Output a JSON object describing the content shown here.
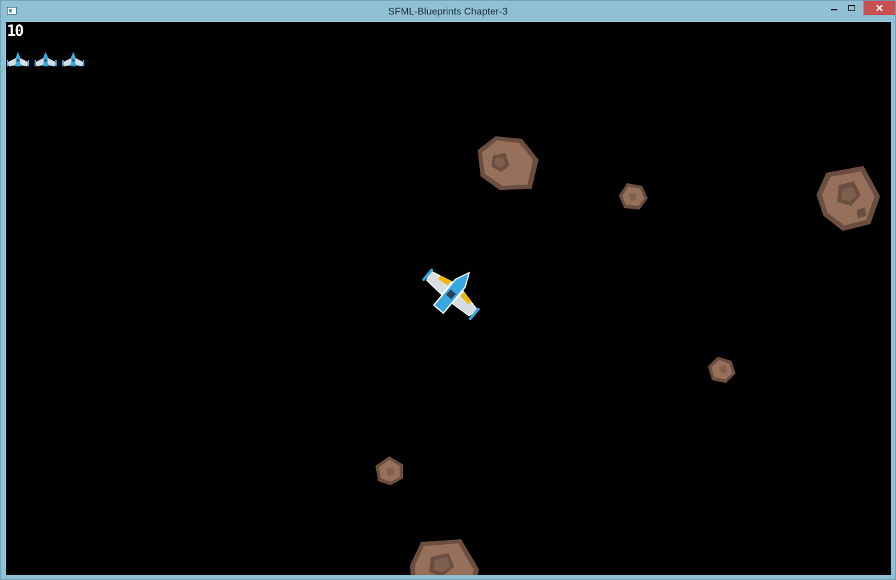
{
  "window": {
    "title": "SFML-Blueprints Chapter-3",
    "close_glyph": "✕"
  },
  "hud": {
    "score": "10",
    "lives": 3
  },
  "colors": {
    "frame": "#8fc0d3",
    "background": "#000000",
    "ship_body": "#36a9e1",
    "ship_wing": "#d6dde0",
    "ship_accent": "#f2b705",
    "meteor_dark": "#6b4e3f",
    "meteor_light": "#96705a",
    "close_button": "#c75050"
  },
  "entities": {
    "player": "spaceship-icon",
    "meteors": [
      "meteor-big-icon",
      "meteor-small-icon",
      "meteor-big-icon",
      "meteor-small-icon",
      "meteor-small-icon",
      "meteor-big-icon"
    ]
  }
}
